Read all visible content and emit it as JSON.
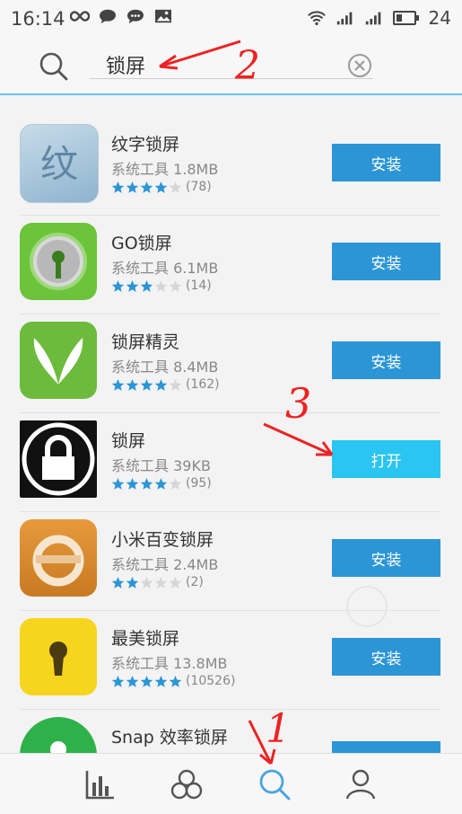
{
  "status_bar": {
    "time": "16:14",
    "battery": "24"
  },
  "search": {
    "query": "锁屏"
  },
  "apps": [
    {
      "name": "纹字锁屏",
      "category": "系统工具",
      "size": "1.8MB",
      "stars": 4,
      "reviews": "(78)",
      "action": "安装",
      "icon": "wenzi-icon"
    },
    {
      "name": "GO锁屏",
      "category": "系统工具",
      "size": "6.1MB",
      "stars": 3,
      "reviews": "(14)",
      "action": "安装",
      "icon": "go-locker-icon"
    },
    {
      "name": "锁屏精灵",
      "category": "系统工具",
      "size": "8.4MB",
      "stars": 4,
      "reviews": "(162)",
      "action": "安装",
      "icon": "jingling-icon"
    },
    {
      "name": "锁屏",
      "category": "系统工具",
      "size": "39KB",
      "stars": 4,
      "reviews": "(95)",
      "action": "打开",
      "icon": "padlock-icon"
    },
    {
      "name": "小米百变锁屏",
      "category": "系统工具",
      "size": "2.4MB",
      "stars": 2,
      "reviews": "(2)",
      "action": "安装",
      "icon": "xiaomi-lock-icon"
    },
    {
      "name": "最美锁屏",
      "category": "系统工具",
      "size": "13.8MB",
      "stars": 5,
      "reviews": "(10526)",
      "action": "安装",
      "icon": "keyhole-icon"
    },
    {
      "name": "Snap 效率锁屏",
      "category": "",
      "size": "",
      "stars": 0,
      "reviews": "",
      "action": "",
      "icon": "snap-lock-icon"
    }
  ],
  "annotations": [
    "2",
    "3",
    "1"
  ],
  "colors": {
    "install_button": "#2b95d6",
    "open_button": "#2ac5f0",
    "star_filled": "#2b95d6",
    "star_empty": "#d6d6d6",
    "annotation": "#ee2222",
    "accent": "#4aa3df"
  },
  "bottom_nav": [
    "rank-chart-icon",
    "categories-icon",
    "search-icon",
    "user-icon"
  ]
}
